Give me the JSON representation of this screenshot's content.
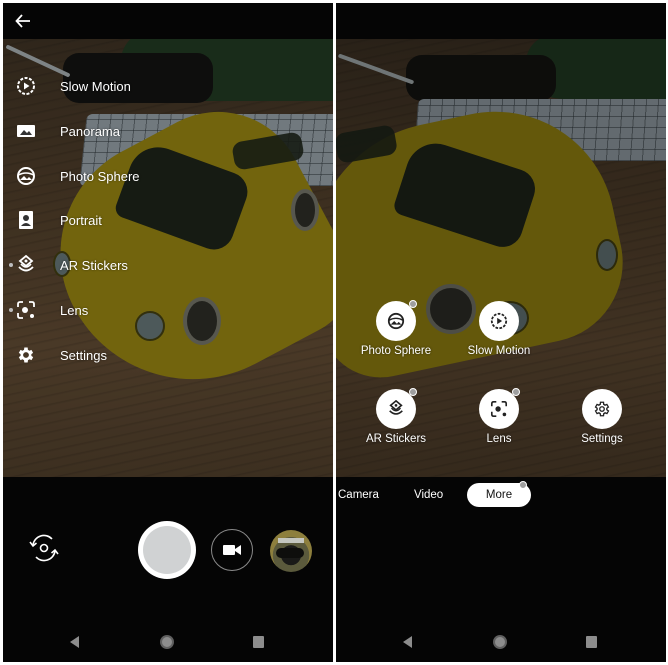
{
  "left_screen": {
    "back_icon": "arrow-left-icon",
    "modes": [
      {
        "label": "Slow Motion",
        "icon": "slow-motion-icon",
        "new": false
      },
      {
        "label": "Panorama",
        "icon": "panorama-icon",
        "new": false
      },
      {
        "label": "Photo Sphere",
        "icon": "photo-sphere-icon",
        "new": false
      },
      {
        "label": "Portrait",
        "icon": "portrait-icon",
        "new": false
      },
      {
        "label": "AR Stickers",
        "icon": "ar-stickers-icon",
        "new": true
      },
      {
        "label": "Lens",
        "icon": "lens-icon",
        "new": true
      },
      {
        "label": "Settings",
        "icon": "gear-icon",
        "new": false
      }
    ],
    "controls": {
      "switch_camera_icon": "switch-camera-icon",
      "shutter": "shutter-button",
      "video_icon": "video-camera-icon",
      "thumbnail": "last-photo-thumbnail"
    }
  },
  "right_screen": {
    "grid": [
      {
        "label": "Photo Sphere",
        "icon": "photo-sphere-icon",
        "new": true
      },
      {
        "label": "Slow Motion",
        "icon": "slow-motion-icon",
        "new": false
      },
      {
        "label": "AR Stickers",
        "icon": "ar-stickers-icon",
        "new": true
      },
      {
        "label": "Lens",
        "icon": "lens-icon",
        "new": true
      },
      {
        "label": "Settings",
        "icon": "gear-icon",
        "new": false
      }
    ],
    "tabs": [
      {
        "label": "Camera",
        "active": false
      },
      {
        "label": "Video",
        "active": false
      },
      {
        "label": "More",
        "active": true
      }
    ]
  },
  "navbar": {
    "back": "nav-back-icon",
    "home": "nav-home-icon",
    "recents": "nav-recents-icon"
  },
  "colors": {
    "background": "#050505",
    "text": "#ffffff",
    "badge": "#9e9e9e",
    "nav_icon": "#8d8d8d"
  }
}
